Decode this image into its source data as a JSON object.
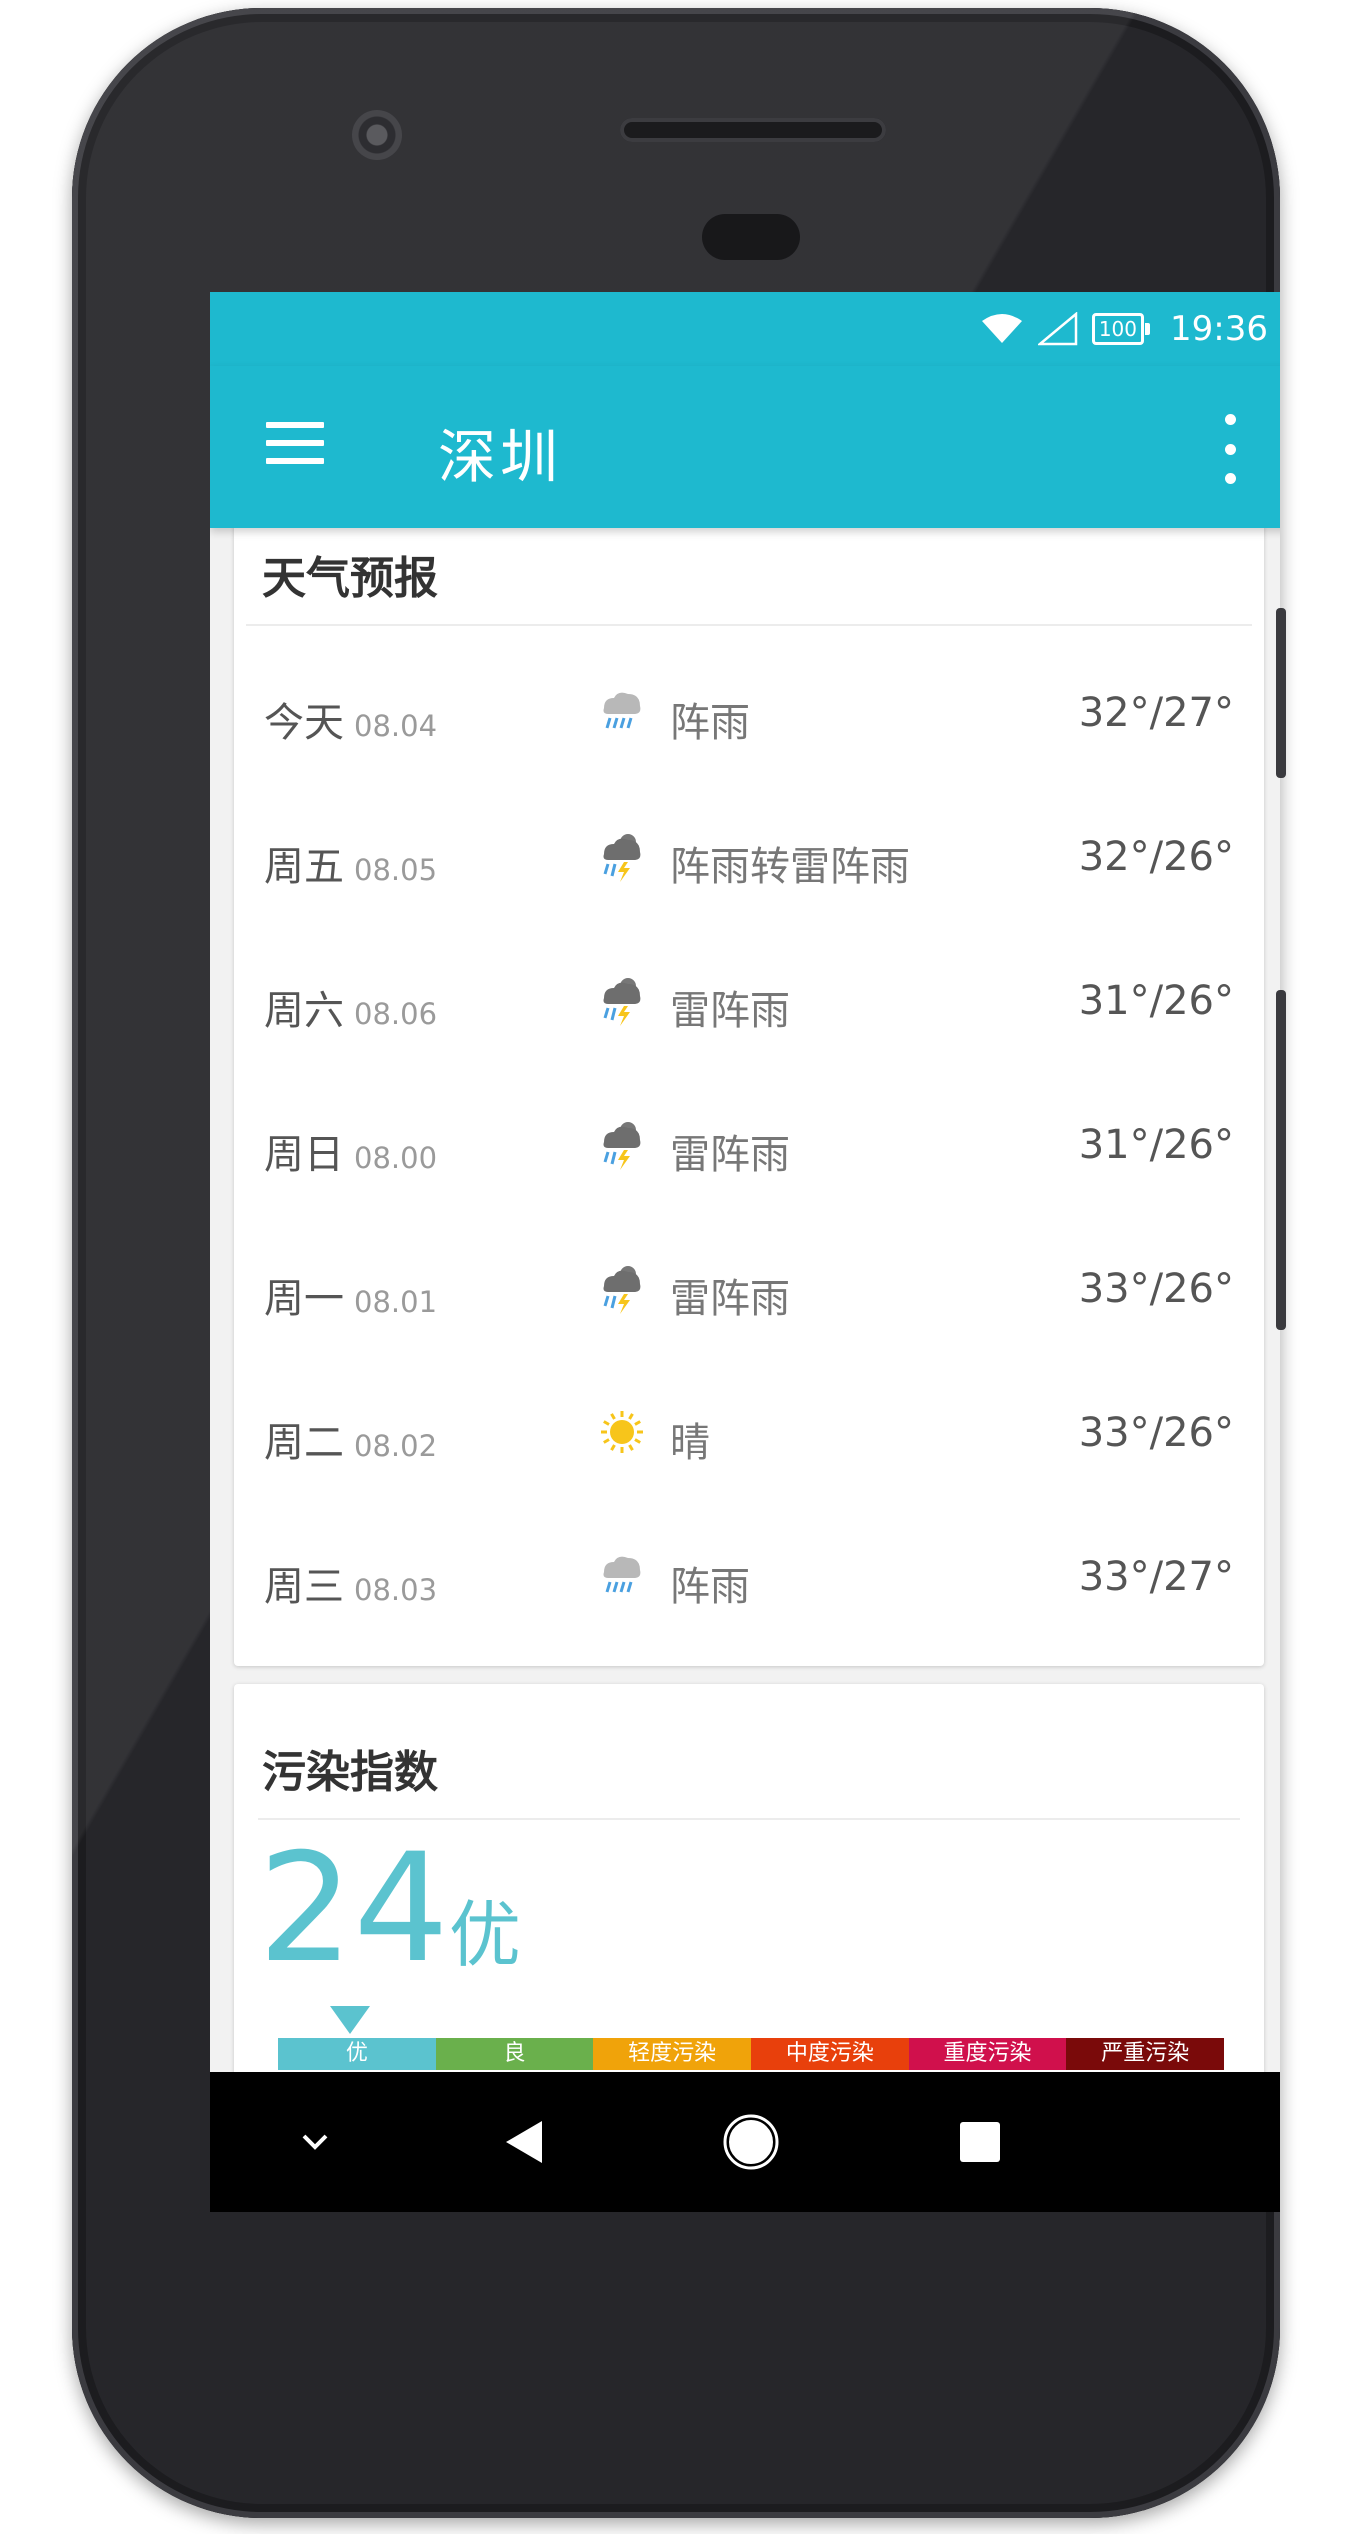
{
  "status_bar": {
    "battery": "100",
    "time": "19:36"
  },
  "toolbar": {
    "title": "深圳"
  },
  "forecast": {
    "title": "天气预报",
    "days": [
      {
        "day": "今天",
        "date": "08.04",
        "icon": "shower-rain-icon",
        "condition": "阵雨",
        "temp": "32°/27°"
      },
      {
        "day": "周五",
        "date": "08.05",
        "icon": "thunder-shower-icon",
        "condition": "阵雨转雷阵雨",
        "temp": "32°/26°"
      },
      {
        "day": "周六",
        "date": "08.06",
        "icon": "thunder-shower-icon",
        "condition": "雷阵雨",
        "temp": "31°/26°"
      },
      {
        "day": "周日",
        "date": "08.00",
        "icon": "thunder-shower-icon",
        "condition": "雷阵雨",
        "temp": "31°/26°"
      },
      {
        "day": "周一",
        "date": "08.01",
        "icon": "thunder-shower-icon",
        "condition": "雷阵雨",
        "temp": "33°/26°"
      },
      {
        "day": "周二",
        "date": "08.02",
        "icon": "sunny-icon",
        "condition": "晴",
        "temp": "33°/26°"
      },
      {
        "day": "周三",
        "date": "08.03",
        "icon": "shower-rain-icon",
        "condition": "阵雨",
        "temp": "33°/27°"
      }
    ]
  },
  "aqi": {
    "title": "污染指数",
    "value": "24",
    "level": "优",
    "scale": [
      {
        "label": "优",
        "color": "#5bc3cf"
      },
      {
        "label": "良",
        "color": "#6ab04c"
      },
      {
        "label": "轻度污染",
        "color": "#f0a30a"
      },
      {
        "label": "中度污染",
        "color": "#e8400c"
      },
      {
        "label": "重度污染",
        "color": "#d0104c"
      },
      {
        "label": "严重污染",
        "color": "#7a0a0a"
      }
    ]
  },
  "colors": {
    "accent": "#1eb9cf",
    "aqi_good": "#5bc3cf"
  }
}
